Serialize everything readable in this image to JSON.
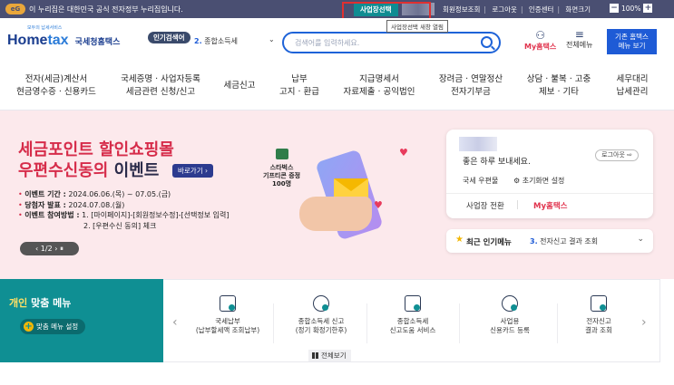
{
  "govbar": {
    "eg_label": "eG",
    "text": "이 누리집은 대한민국 공식 전자정부 누리집입니다.",
    "biz_select": "사업장선택",
    "links": [
      "회원정보조회",
      "로그아웃",
      "인증센터",
      "화면크기"
    ],
    "zoom": "100%",
    "tooltip": "사업장선택 새창 열림"
  },
  "header": {
    "logo_brand_a": "Home",
    "logo_brand_b": "tax",
    "logo_kor": "국세청홈택스",
    "logo_tiny": "모두의 납세서비스",
    "popular_label": "인기검색어",
    "popular_num": "2.",
    "popular_item": "종합소득세",
    "search_placeholder": "검색어를 입력하세요.",
    "my_hometax": "My홈택스",
    "all_menu": "전체메뉴",
    "basic_btn_line1": "기존 홈택스",
    "basic_btn_line2": "메뉴 보기"
  },
  "nav": [
    {
      "l1": "전자(세금)계산서",
      "l2": "현금영수증 · 신용카드"
    },
    {
      "l1": "국세증명 · 사업자등록",
      "l2": "세금관련 신청/신고"
    },
    {
      "l1": "세금신고",
      "l2": ""
    },
    {
      "l1": "납부",
      "l2": "고지 · 환급"
    },
    {
      "l1": "지급명세서",
      "l2": "자료제출 · 공익법인"
    },
    {
      "l1": "장려금 · 연말정산",
      "l2": "전자기부금"
    },
    {
      "l1": "상담 · 불복 · 고충",
      "l2": "제보 · 기타"
    },
    {
      "l1": "세무대리",
      "l2": "납세관리"
    }
  ],
  "banner": {
    "title1": "세금포인트 할인쇼핑몰",
    "title2_red": "우편수신동의",
    "title2_dark": " 이벤트",
    "go_btn": "바로가기 ›",
    "info": [
      {
        "k": "이벤트 기간 :",
        "v": " 2024.06.06.(목) ~ 07.05.(금)"
      },
      {
        "k": "당첨자 발표 :",
        "v": " 2024.07.08.(월)"
      },
      {
        "k": "이벤트 참여방법 :",
        "v": " 1. [마이페이지]-[회원정보수정]-[선택정보 입력]"
      }
    ],
    "info_line4": "2. [우편수신 동의] 체크",
    "pager": "‹  1/2  ›  ⏸",
    "coupon_l1": "스타벅스",
    "coupon_l2": "기프티콘 증정",
    "coupon_l3": "100명"
  },
  "card": {
    "greet": "좋은 하루 보내세요.",
    "logout": "로그아웃 ⇨",
    "mail": "국세 우편물",
    "initset": "⚙ 초기화면 설정",
    "biz_switch": "사업장 전환",
    "my_hometax": "My홈택스"
  },
  "popmenu": {
    "title": "최근 인기메뉴",
    "num": "3.",
    "item": " 전자신고 결과 조회"
  },
  "personal": {
    "title_a": "개인",
    "title_b": " 맞춤 메뉴",
    "setting": "맞춤 메뉴 설정",
    "items": [
      {
        "l1": "국세납부",
        "l2": "(납부할세액 조회납부)"
      },
      {
        "l1": "종합소득세 신고",
        "l2": "(정기 확정기한후)"
      },
      {
        "l1": "종합소득세",
        "l2": "신고도움 서비스"
      },
      {
        "l1": "사업용",
        "l2": "신용카드 등록"
      },
      {
        "l1": "전자신고",
        "l2": "결과 조회"
      }
    ],
    "all_view": "전체보기"
  }
}
